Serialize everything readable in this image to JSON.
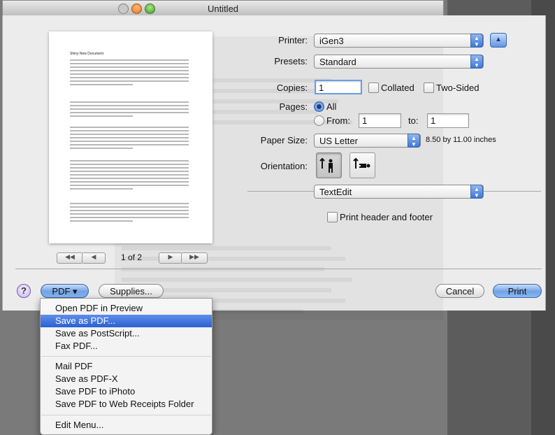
{
  "window": {
    "title": "Untitled"
  },
  "preview": {
    "doc_title": "Shiny New Document",
    "page_indicator": "1 of 2",
    "first_label": "◀◀",
    "prev_label": "◀",
    "next_label": "▶",
    "last_label": "▶▶"
  },
  "printer": {
    "label": "Printer:",
    "value": "iGen3"
  },
  "presets": {
    "label": "Presets:",
    "value": "Standard"
  },
  "copies": {
    "label": "Copies:",
    "value": "1",
    "collated_label": "Collated",
    "two_sided_label": "Two-Sided"
  },
  "pages": {
    "label": "Pages:",
    "all_label": "All",
    "from_label": "From:",
    "from_value": "1",
    "to_label": "to:",
    "to_value": "1"
  },
  "paper_size": {
    "label": "Paper Size:",
    "value": "US Letter",
    "dimensions": "8.50 by 11.00 inches"
  },
  "orientation": {
    "label": "Orientation:"
  },
  "app_section": {
    "value": "TextEdit"
  },
  "header_footer": {
    "label": "Print header and footer"
  },
  "bottom": {
    "help_label": "?",
    "pdf_label": "PDF ▾",
    "supplies_label": "Supplies...",
    "cancel_label": "Cancel",
    "print_label": "Print"
  },
  "pdf_menu": {
    "items": [
      "Open PDF in Preview",
      "Save as PDF...",
      "Save as PostScript...",
      "Fax PDF...",
      "Mail PDF",
      "Save as PDF-X",
      "Save PDF to iPhoto",
      "Save PDF to Web Receipts Folder",
      "Edit Menu..."
    ]
  },
  "colors": {
    "accent": "#3d78d8",
    "highlight": "#2960d4"
  }
}
